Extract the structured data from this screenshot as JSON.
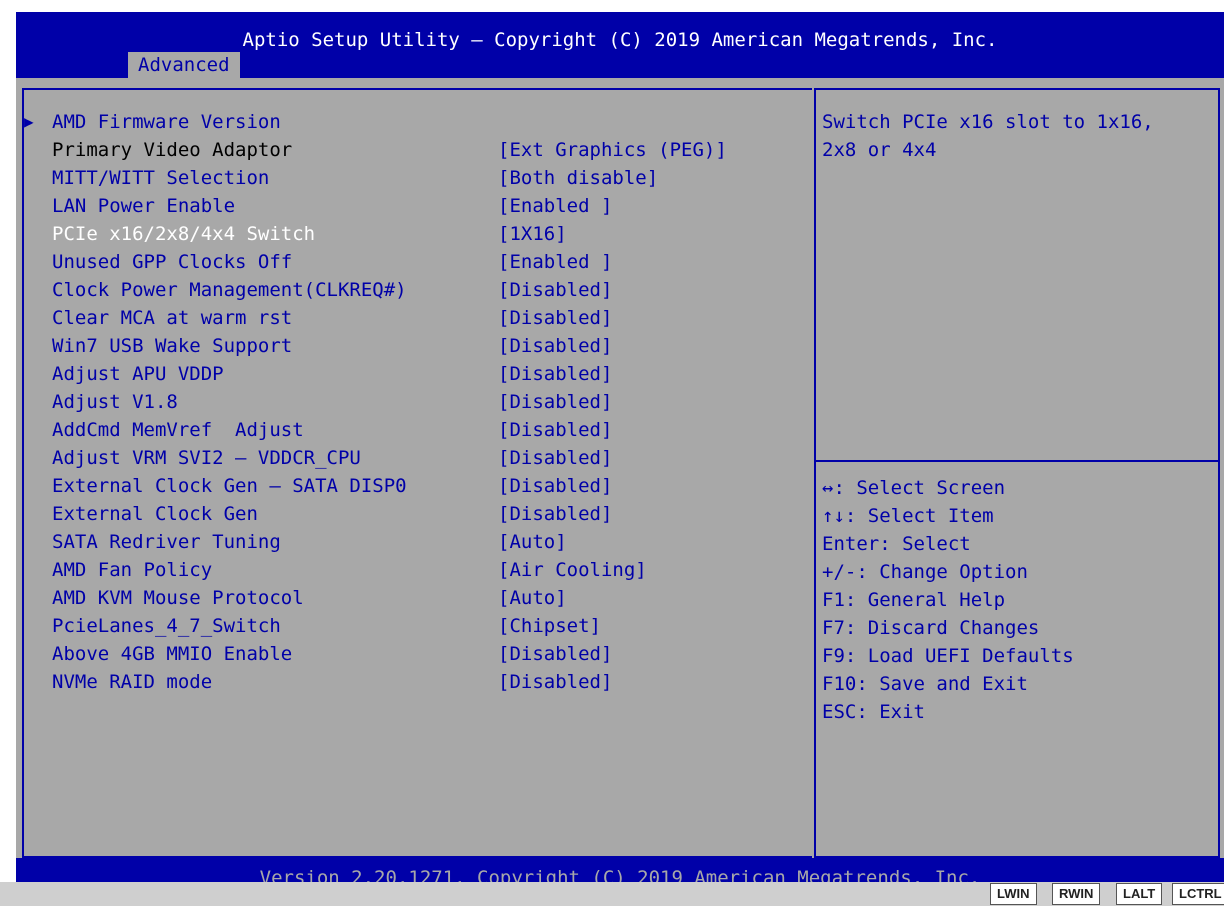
{
  "header": {
    "title": "Aptio Setup Utility – Copyright (C) 2019 American Megatrends, Inc.",
    "tab": "Advanced"
  },
  "menu": {
    "items": [
      {
        "label": "AMD Firmware Version",
        "value": ""
      },
      {
        "label": "Primary Video Adaptor",
        "value": "[Ext Graphics (PEG)]"
      },
      {
        "label": "MITT/WITT Selection",
        "value": "[Both disable]"
      },
      {
        "label": "LAN Power Enable",
        "value": "[Enabled ]"
      },
      {
        "label": "PCIe x16/2x8/4x4 Switch",
        "value": "[1X16]"
      },
      {
        "label": "Unused GPP Clocks Off",
        "value": "[Enabled ]"
      },
      {
        "label": "Clock Power Management(CLKREQ#)",
        "value": "[Disabled]"
      },
      {
        "label": "Clear MCA at warm rst",
        "value": "[Disabled]"
      },
      {
        "label": "Win7 USB Wake Support",
        "value": "[Disabled]"
      },
      {
        "label": "Adjust APU VDDP",
        "value": "[Disabled]"
      },
      {
        "label": "Adjust V1.8",
        "value": "[Disabled]"
      },
      {
        "label": "AddCmd MemVref  Adjust",
        "value": "[Disabled]"
      },
      {
        "label": "Adjust VRM SVI2 – VDDCR_CPU",
        "value": "[Disabled]"
      },
      {
        "label": "External Clock Gen – SATA DISP0",
        "value": "[Disabled]"
      },
      {
        "label": "External Clock Gen",
        "value": "[Disabled]"
      },
      {
        "label": "SATA Redriver Tuning",
        "value": "[Auto]"
      },
      {
        "label": "AMD Fan Policy",
        "value": "[Air Cooling]"
      },
      {
        "label": "AMD KVM Mouse Protocol",
        "value": "[Auto]"
      },
      {
        "label": "PcieLanes_4_7_Switch",
        "value": "[Chipset]"
      },
      {
        "label": "Above 4GB MMIO Enable",
        "value": "[Disabled]"
      },
      {
        "label": "NVMe RAID mode",
        "value": "[Disabled]"
      }
    ]
  },
  "help": {
    "description": [
      "Switch PCIe x16 slot to 1x16,",
      "2x8 or 4x4"
    ],
    "keys": [
      "↔: Select Screen",
      "↑↓: Select Item",
      "Enter: Select",
      "+/-: Change Option",
      "F1: General Help",
      "F7: Discard Changes",
      "F9: Load UEFI Defaults",
      "F10: Save and Exit",
      "ESC: Exit"
    ]
  },
  "footer": {
    "version": "Version 2.20.1271. Copyright (C) 2019 American Megatrends, Inc."
  },
  "kvm_keys": [
    "LWIN",
    "RWIN",
    "LALT",
    "LCTRL"
  ],
  "colors": {
    "bios_blue": "#0000a8",
    "bios_gray": "#a8a8a8",
    "selected_text": "#ffffff"
  }
}
